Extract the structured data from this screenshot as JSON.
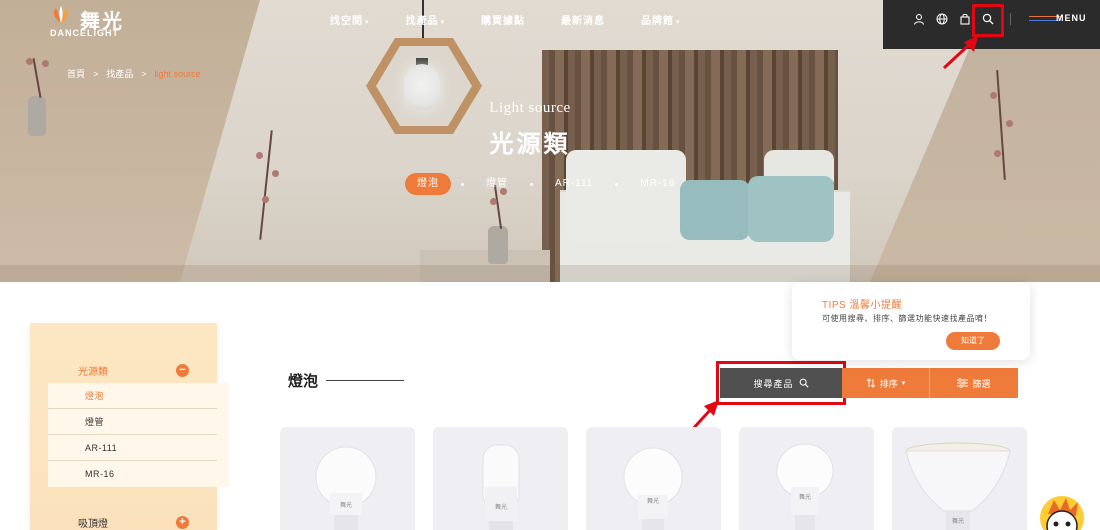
{
  "brand": {
    "name_cn": "舞光",
    "name_en": "DANCELiGHT"
  },
  "nav": [
    {
      "label": "找空間",
      "caret": "▾"
    },
    {
      "label": "找產品",
      "caret": "▾"
    },
    {
      "label": "購買據點",
      "caret": ""
    },
    {
      "label": "最新消息",
      "caret": ""
    },
    {
      "label": "品牌館",
      "caret": "▾"
    }
  ],
  "utility": {
    "menu_label": "MENU",
    "icons": [
      "user-icon",
      "globe-icon",
      "bag-icon",
      "search-icon"
    ]
  },
  "breadcrumb": {
    "home": "首頁",
    "level1": "找產品",
    "current": "light source",
    "separator": ">"
  },
  "hero": {
    "eyebrow": "Light source",
    "title": "光源類",
    "tabs": [
      {
        "label": "燈泡",
        "active": true
      },
      {
        "label": "燈管",
        "active": false
      },
      {
        "label": "AR-111",
        "active": false
      },
      {
        "label": "MR-16",
        "active": false
      }
    ]
  },
  "sidebar": {
    "categories": [
      {
        "label": "光源類",
        "toggle": "−",
        "expanded": true,
        "active": true
      },
      {
        "label": "吸頂燈",
        "toggle": "+",
        "expanded": false,
        "active": false
      }
    ],
    "subitems": [
      {
        "label": "燈泡",
        "active": true
      },
      {
        "label": "燈管",
        "active": false
      },
      {
        "label": "AR-111",
        "active": false
      },
      {
        "label": "MR-16",
        "active": false
      }
    ]
  },
  "section": {
    "title": "燈泡"
  },
  "filters": {
    "search_label": "搜尋產品",
    "sort_label": "排序",
    "filter_label": "篩選"
  },
  "tips": {
    "title": "TIPS 溫馨小提醒",
    "body": "可使用搜尋、排序、篩選功能快速找產品唷！",
    "button": "知道了"
  },
  "products": [
    {
      "shape": "a-bulb"
    },
    {
      "shape": "tube-bulb"
    },
    {
      "shape": "a-bulb"
    },
    {
      "shape": "a-bulb"
    },
    {
      "shape": "par-bulb"
    }
  ],
  "colors": {
    "accent": "#ef7b3b",
    "dark": "#2b2b2b",
    "highlight": "#e30613",
    "sidebar_bg": "#fde7c3"
  }
}
